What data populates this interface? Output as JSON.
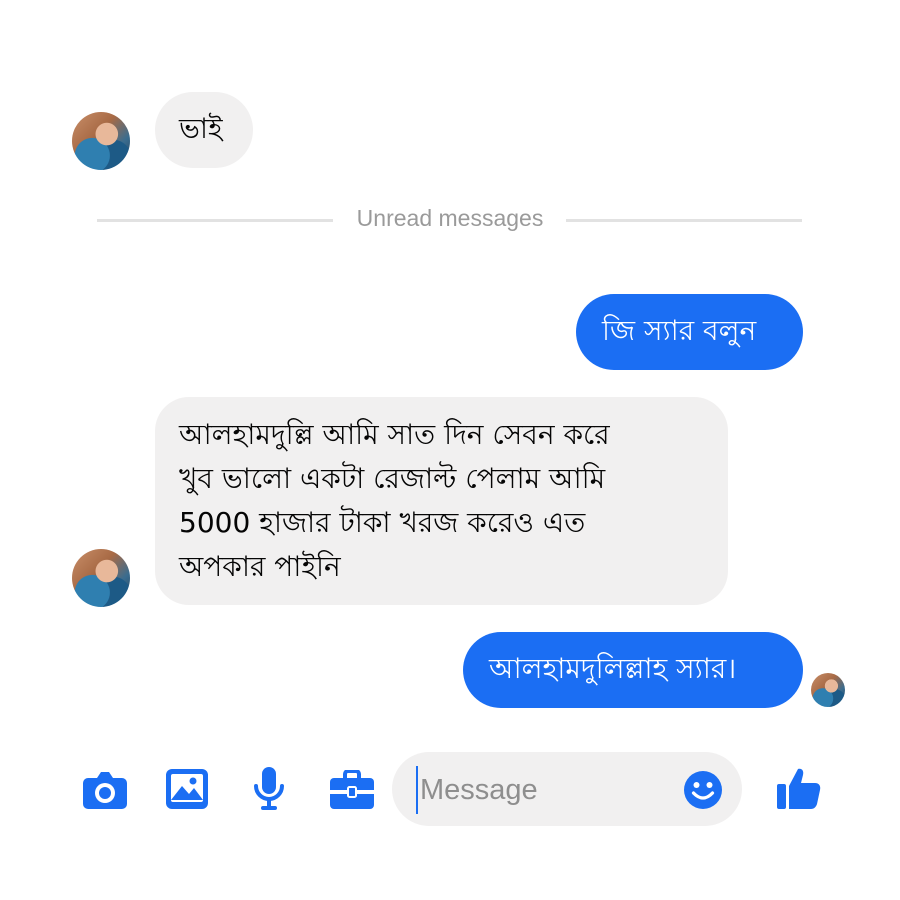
{
  "messages": [
    {
      "direction": "incoming",
      "text": "ভাই"
    },
    {
      "direction": "outgoing",
      "text": "জি স্যার বলুন"
    },
    {
      "direction": "incoming",
      "text": "আলহামদুল্লি আমি সাত দিন সেবন করে\nখুব ভালো একটা রেজাল্ট পেলাম আমি\n5000 হাজার টাকা খরজ করেও এত\nঅপকার পাইনি"
    },
    {
      "direction": "outgoing",
      "text": "আলহামদুলিল্লাহ স্যার।"
    }
  ],
  "divider": {
    "label": "Unread messages"
  },
  "composer": {
    "placeholder": "Message",
    "icons": [
      "camera-icon",
      "image-icon",
      "microphone-icon",
      "toolbox-icon",
      "emoji-icon",
      "thumbs-up-icon"
    ]
  },
  "colors": {
    "accent": "#1b6ef3",
    "incoming_bubble": "#f1f0f0",
    "divider": "#e2e2e2"
  }
}
